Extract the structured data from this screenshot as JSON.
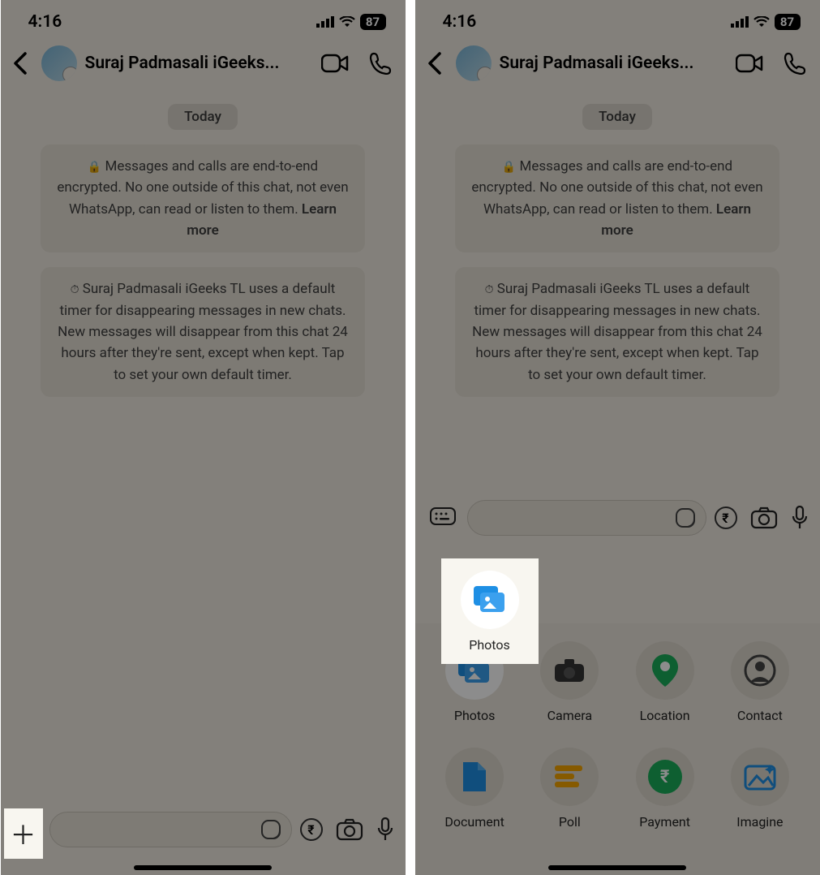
{
  "status": {
    "time": "4:16",
    "battery": "87"
  },
  "header": {
    "contact_name": "Suraj Padmasali iGeeks..."
  },
  "chat": {
    "date_label": "Today",
    "encryption_msg": "Messages and calls are end-to-end encrypted. No one outside of this chat, not even WhatsApp, can read or listen to them.",
    "learn_more": "Learn more",
    "timer_msg": "Suraj Padmasali iGeeks TL uses a default timer for disappearing messages in new chats. New messages will disappear from this chat 24 hours after they're sent, except when kept. Tap to set your own default timer."
  },
  "attach": {
    "items": [
      {
        "label": "Photos"
      },
      {
        "label": "Camera"
      },
      {
        "label": "Location"
      },
      {
        "label": "Contact"
      },
      {
        "label": "Document"
      },
      {
        "label": "Poll"
      },
      {
        "label": "Payment"
      },
      {
        "label": "Imagine"
      }
    ]
  },
  "rupee": "₹"
}
